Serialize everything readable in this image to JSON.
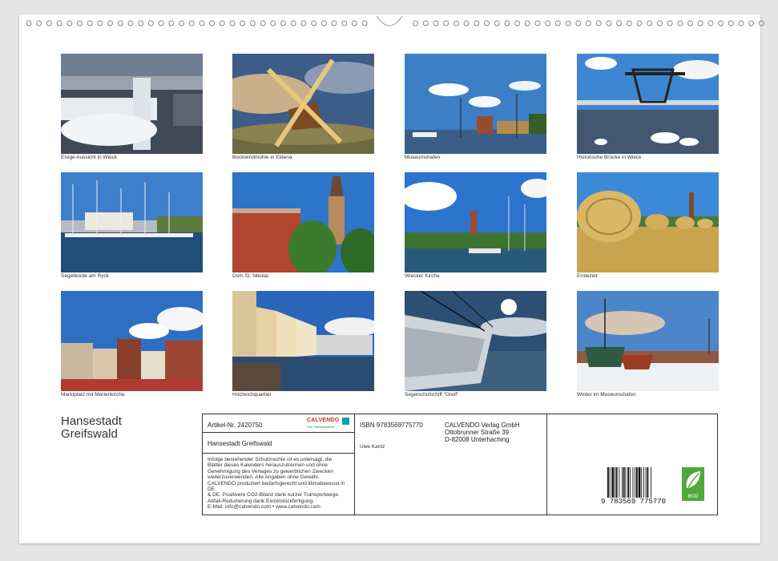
{
  "photos": [
    {
      "caption": "Eisige Aussicht in Wieck"
    },
    {
      "caption": "Bockwindmühle in Eldena"
    },
    {
      "caption": "Museumshafen"
    },
    {
      "caption": "Historische Brücke in Wieck"
    },
    {
      "caption": "Segelboote am Ryck"
    },
    {
      "caption": "Dom St. Nikolai"
    },
    {
      "caption": "Wiecker Kirche"
    },
    {
      "caption": "Erntezeit"
    },
    {
      "caption": "Marktplatz mit Marienkirche"
    },
    {
      "caption": "Holzteichquartier"
    },
    {
      "caption": "Segelschulschiff \"Greif\""
    },
    {
      "caption": "Winter im Museumshafen"
    }
  ],
  "title": {
    "line1": "Hansestadt",
    "line2": "Greifswald"
  },
  "info": {
    "article": "Artikel-Nr. 2420750",
    "brand": "CALVENDO",
    "brand_sub": "Das Standarddruck",
    "product_title": "Hansestadt Greifswald",
    "legal": [
      "Infolge bestehender Schutzrechte ist es untersagt, die",
      "Blätter dieses Kalenders herauszutrennen und ohne",
      "Genehmigung des Verlages zu gewerblichen Zwecken",
      "weiterzuverwenden. Alle Angaben ohne Gewähr.",
      "CALVENDO produziert bedarfsgerecht und klimabewusst in DE",
      "& DE. Positivere CO2-Bilanz dank kurzer Transportwege.",
      "Abfall-Reduzierung dank Einzelstückfertigung.",
      "E-Mail: info@calvendo.com • www.calvendo.com"
    ],
    "isbn": "ISBN 9783569775770",
    "publisher": [
      "CALVENDO Verlag GmbH",
      "Ottobrunner Straße 39",
      "D-82008 Unterhaching"
    ],
    "author": "Uwe Kantz",
    "barcode_digits": [
      "9",
      "783569",
      "775770"
    ],
    "eco_label": "eco"
  }
}
